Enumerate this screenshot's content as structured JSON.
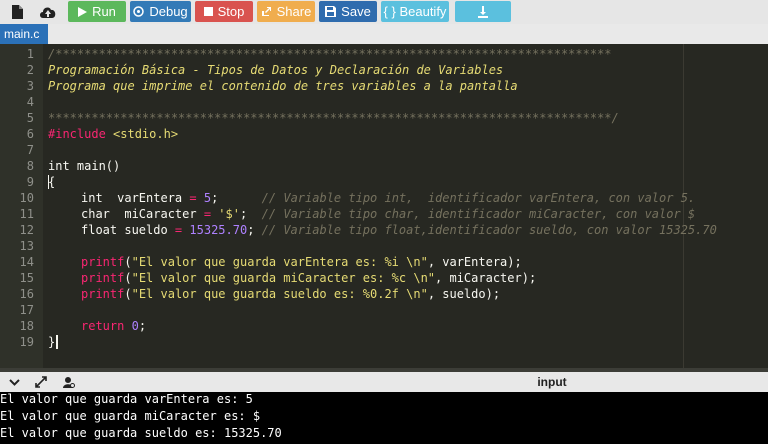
{
  "toolbar": {
    "run_label": "Run",
    "debug_label": "Debug",
    "stop_label": "Stop",
    "share_label": "Share",
    "save_label": "Save",
    "beautify_label": "{ } Beautify"
  },
  "tab": {
    "filename": "main.c"
  },
  "editor": {
    "line_numbers": [
      "1",
      "2",
      "3",
      "4",
      "5",
      "6",
      "7",
      "8",
      "9",
      "10",
      "11",
      "12",
      "13",
      "14",
      "15",
      "16",
      "17",
      "18",
      "19"
    ],
    "code": {
      "l1": "/*****************************************************************************",
      "l2": "Programación Básica - Tipos de Datos y Declaración de Variables",
      "l3": "Programa que imprime el contenido de tres variables a la pantalla",
      "l5": "******************************************************************************/",
      "l6_directive": "#include",
      "l6_header": "<stdio.h>",
      "l8_type": "int",
      "l8_rest": " main()",
      "l9": "{",
      "l10_type": "int",
      "l10_name": "  varEntera ",
      "l10_op": "=",
      "l10_sp": " ",
      "l10_val": "5",
      "l10_semi": ";      ",
      "l10_comment": "// Variable tipo int,  identificador varEntera, con valor 5.",
      "l11_type": "char",
      "l11_name": "  miCaracter ",
      "l11_op": "=",
      "l11_sp": " ",
      "l11_val": "'$'",
      "l11_semi": ";  ",
      "l11_comment": "// Variable tipo char, identificador miCaracter, con valor $",
      "l12_type": "float",
      "l12_name": " sueldo ",
      "l12_op": "=",
      "l12_sp": " ",
      "l12_val": "15325.70",
      "l12_semi": "; ",
      "l12_comment": "// Variable tipo float,identificador sueldo, con valor 15325.70",
      "l14_fn": "printf",
      "l14_open": "(",
      "l14_str": "\"El valor que guarda varEntera es: %i \\n\"",
      "l14_rest": ", varEntera);",
      "l15_fn": "printf",
      "l15_open": "(",
      "l15_str": "\"El valor que guarda miCaracter es: %c \\n\"",
      "l15_rest": ", miCaracter);",
      "l16_fn": "printf",
      "l16_open": "(",
      "l16_str": "\"El valor que guarda sueldo es: %0.2f \\n\"",
      "l16_rest": ", sueldo);",
      "l18_kw": "return",
      "l18_sp": " ",
      "l18_val": "0",
      "l18_semi": ";",
      "l19": "}"
    }
  },
  "console": {
    "input_label": "input",
    "output": [
      "El valor que guarda varEntera es: 5",
      "El valor que guarda miCaracter es: $",
      "El valor que guarda sueldo es: 15325.70"
    ]
  },
  "icons": {
    "new_file": "file-icon",
    "upload": "cloud-upload-icon",
    "run": "play-icon",
    "debug": "target-icon",
    "stop": "stop-icon",
    "share": "share-icon",
    "save": "floppy-icon",
    "download": "download-icon",
    "collapse": "chevron-down-icon",
    "expand": "expand-arrows-icon",
    "settings": "gear-user-icon"
  },
  "colors": {
    "run": "#5cb85c",
    "debug": "#337ab7",
    "stop": "#d9534f",
    "share": "#f0ad4e",
    "save": "#2f6cae",
    "beautify": "#5bc0de",
    "tab": "#2b71b8",
    "editor_bg": "#272822"
  }
}
